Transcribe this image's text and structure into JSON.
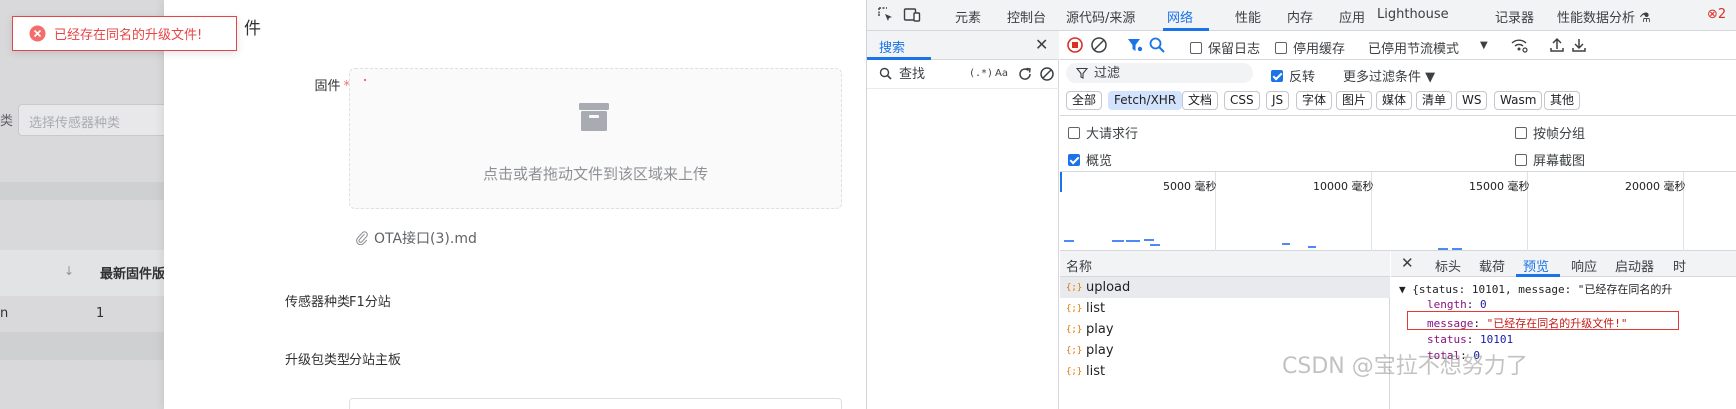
{
  "background_page": {
    "filter_label": "类",
    "sensor_select_placeholder": "选择传感器种类",
    "sort_icon": "↓",
    "column_header": "最新固件版",
    "cell_a": "n",
    "cell_b": "1"
  },
  "drawer": {
    "title": "件",
    "firmware_label": "固件",
    "required_mark": "*",
    "upload_hint": "点击或者拖动文件到该区域来上传",
    "uploaded_file": "OTA接口(3).md",
    "sensor_label": "传感器种类",
    "sensor_value": "F1分站",
    "package_label": "升级包类型",
    "package_value": "分站主板"
  },
  "toast": {
    "message": "已经存在同名的升级文件!",
    "color": "#f56c6c"
  },
  "devtools": {
    "tabs": [
      "元素",
      "控制台",
      "源代码/来源",
      "网络",
      "性能",
      "内存",
      "应用",
      "Lighthouse",
      "记录器",
      "性能数据分析 ⚗"
    ],
    "active_tab": "网络",
    "tab_overflow": "2",
    "search_pane": {
      "title": "搜索",
      "close": "✕",
      "input_placeholder": "查找",
      "regex_toggle": "(.*)",
      "case_toggle": "Aa"
    },
    "toolbar": {
      "preserve_log": "保留日志",
      "disable_cache": "停用缓存",
      "throttle": "已停用节流模式"
    },
    "filter": {
      "placeholder": "过滤",
      "invert": "反转",
      "more_filters": "更多过滤条件 ▼"
    },
    "type_filters": [
      "全部",
      "Fetch/XHR",
      "文档",
      "CSS",
      "JS",
      "字体",
      "图片",
      "媒体",
      "清单",
      "WS",
      "Wasm",
      "其他"
    ],
    "active_type": "Fetch/XHR",
    "options": {
      "big_request_rows": "大请求行",
      "group_by_frame": "按帧分组",
      "overview": "概览",
      "screenshots": "屏幕截图"
    },
    "overview_ticks": [
      "5000 毫秒",
      "10000 毫秒",
      "15000 毫秒",
      "20000 毫秒"
    ],
    "requests_header": "名称",
    "requests": [
      {
        "name": "upload",
        "icon": "{;}",
        "selected": true
      },
      {
        "name": "list",
        "icon": "{;}",
        "selected": false
      },
      {
        "name": "play",
        "icon": "{;}",
        "selected": false
      },
      {
        "name": "play",
        "icon": "{;}",
        "selected": false
      },
      {
        "name": "list",
        "icon": "{;}",
        "selected": false
      }
    ],
    "detail_tabs": [
      "标头",
      "载荷",
      "预览",
      "响应",
      "启动器",
      "时"
    ],
    "active_detail_tab": "预览",
    "preview": {
      "summary": "▼ {status: 10101, message: \"已经存在同名的升",
      "length_key": "length",
      "length_value": "0",
      "message_key": "message",
      "message_value": "\"已经存在同名的升级文件!\"",
      "status_key": "status",
      "status_value": "10101",
      "total_key": "total",
      "total_value": "0"
    }
  },
  "watermark": "CSDN @宝拉不想努力了"
}
